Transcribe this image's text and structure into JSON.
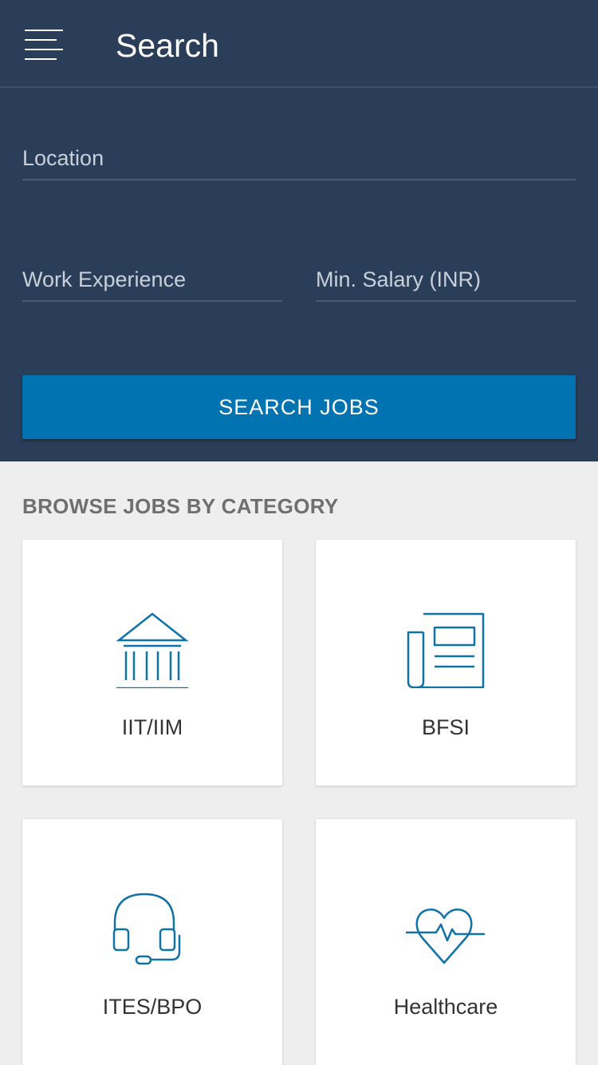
{
  "header": {
    "menu_icon": "hamburger-menu-icon",
    "title": "Search"
  },
  "search_form": {
    "location": {
      "placeholder": "Location",
      "value": ""
    },
    "work_experience": {
      "placeholder": "Work Experience",
      "value": ""
    },
    "min_salary": {
      "placeholder": "Min. Salary (INR)",
      "value": ""
    },
    "submit_label": "SEARCH JOBS"
  },
  "browse": {
    "heading": "BROWSE JOBS BY CATEGORY",
    "categories": [
      {
        "label": "IIT/IIM",
        "icon": "institution-icon"
      },
      {
        "label": "BFSI",
        "icon": "newspaper-icon"
      },
      {
        "label": "ITES/BPO",
        "icon": "headset-icon"
      },
      {
        "label": "Healthcare",
        "icon": "heartbeat-icon"
      }
    ]
  },
  "colors": {
    "header_background": "#2b3e59",
    "accent_blue": "#0073b0",
    "page_background": "#eeeeee",
    "icon_stroke": "#0f73a8"
  }
}
